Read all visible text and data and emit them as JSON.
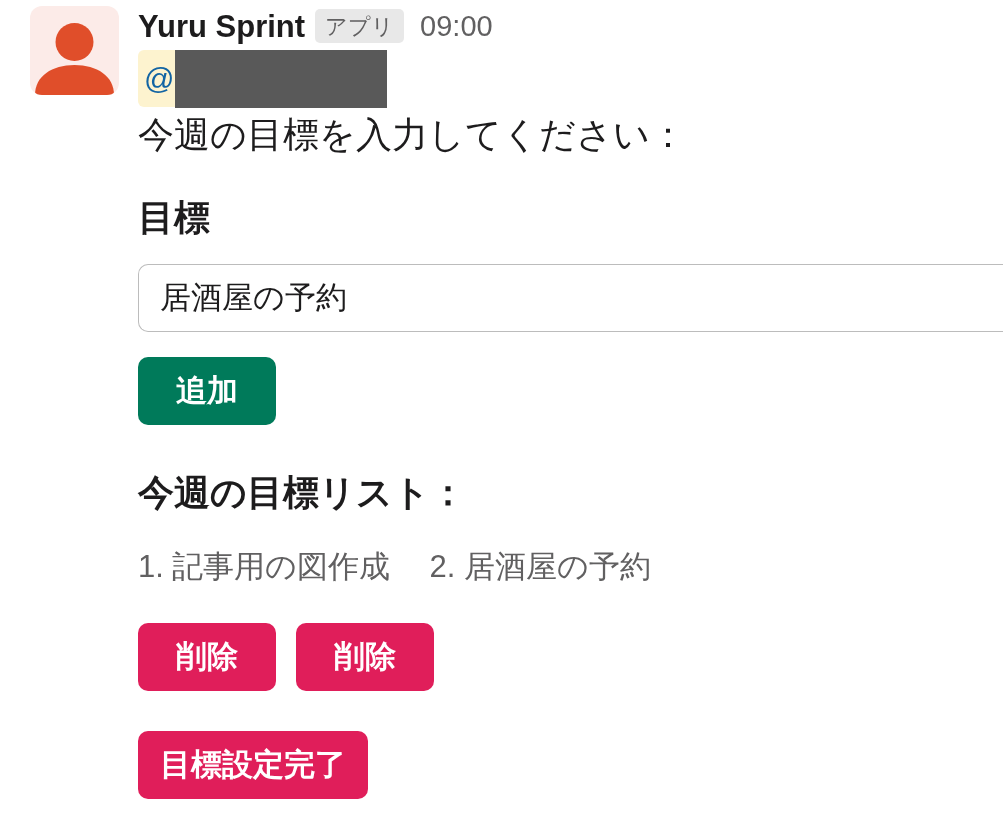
{
  "message": {
    "sender": "Yuru Sprint",
    "badge": "アプリ",
    "time": "09:00",
    "mention": {
      "prefix": "@",
      "redacted": true
    },
    "blocks": [
      {
        "kind": "text",
        "text": "今週の目標を入力してください："
      },
      {
        "kind": "label",
        "text": "目標"
      },
      {
        "kind": "input",
        "value": "居酒屋の予約"
      },
      {
        "kind": "buttons",
        "buttons": [
          {
            "kind": "add",
            "label": "追加"
          }
        ]
      },
      {
        "kind": "header",
        "text": "今週の目標リスト："
      },
      {
        "kind": "list",
        "items": [
          "1. 記事用の図作成",
          "2. 居酒屋の予約"
        ]
      },
      {
        "kind": "buttons",
        "buttons": [
          {
            "kind": "delete",
            "label": "削除"
          },
          {
            "kind": "delete",
            "label": "削除"
          }
        ]
      },
      {
        "kind": "buttons",
        "buttons": [
          {
            "kind": "finish",
            "label": "目標設定完了"
          }
        ]
      }
    ]
  }
}
